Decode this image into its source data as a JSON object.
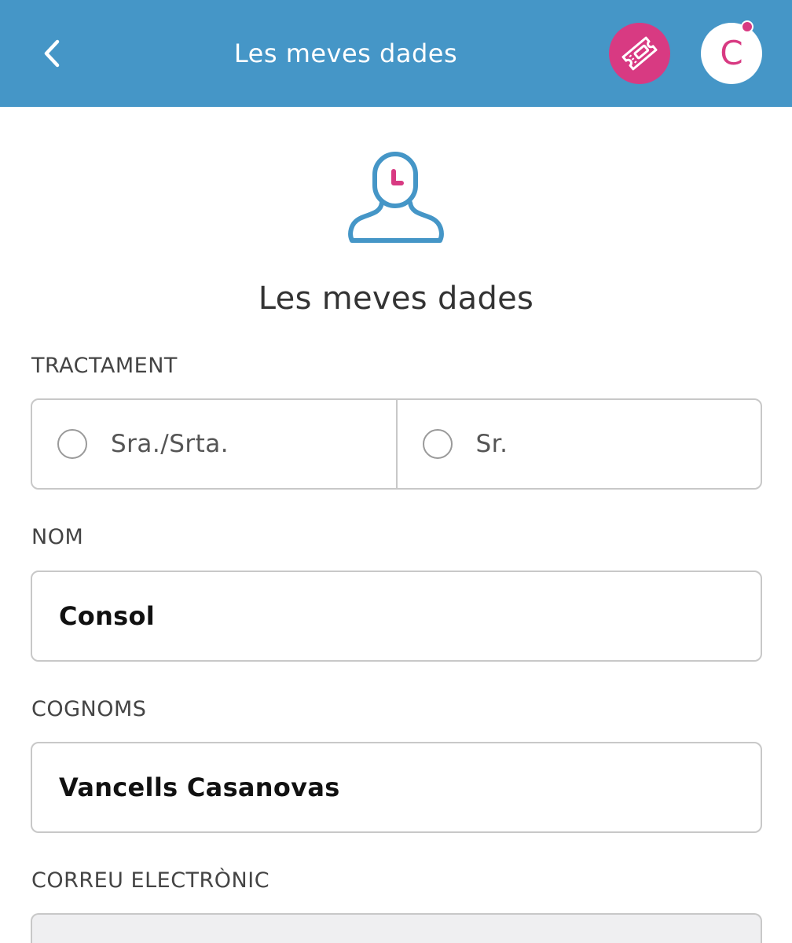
{
  "header": {
    "title": "Les meves dades",
    "back_icon": "chevron-left-icon",
    "ticket_icon": "ticket-icon",
    "avatar_initial": "C",
    "accent_color": "#4596c7",
    "brand_color": "#d83a82"
  },
  "profile": {
    "icon": "user-profile-icon",
    "title": "Les meves dades"
  },
  "form": {
    "tractament": {
      "label": "TRACTAMENT",
      "options": [
        {
          "label": "Sra./Srta.",
          "selected": false
        },
        {
          "label": "Sr.",
          "selected": false
        }
      ]
    },
    "nom": {
      "label": "NOM",
      "value": "Consol"
    },
    "cognoms": {
      "label": "COGNOMS",
      "value": "Vancells Casanovas"
    },
    "correu": {
      "label": "CORREU ELECTRÒNIC",
      "value": ""
    }
  }
}
